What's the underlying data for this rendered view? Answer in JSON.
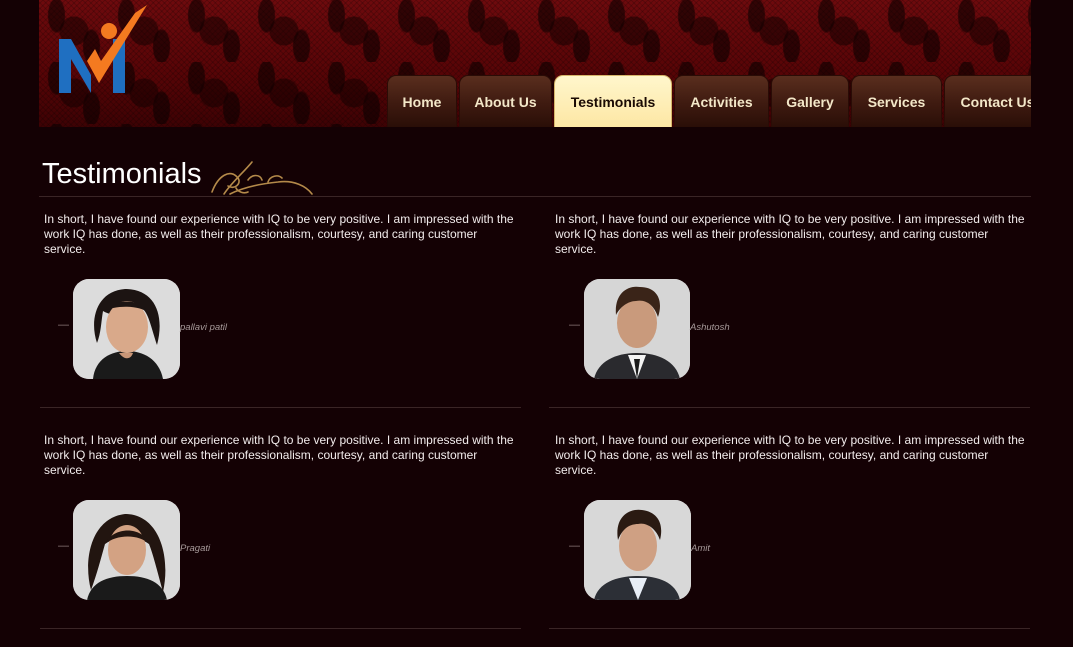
{
  "brand": {
    "accent": "#f47a20",
    "logo_blue": "#1f6fc1"
  },
  "nav": {
    "tabs": [
      {
        "label": "Home",
        "active": false
      },
      {
        "label": "About Us",
        "active": false
      },
      {
        "label": "Testimonials",
        "active": true
      },
      {
        "label": "Activities",
        "active": false
      },
      {
        "label": "Gallery",
        "active": false
      },
      {
        "label": "Services",
        "active": false
      },
      {
        "label": "Contact Us",
        "active": false
      }
    ]
  },
  "page": {
    "title": "Testimonials"
  },
  "testimonials": [
    {
      "quote": "In short, I have found our experience with IQ to be very positive. I am impressed with the work IQ has done, as well as their professionalism, courtesy, and caring customer service.",
      "dash": "—",
      "name": "pallavi patil"
    },
    {
      "quote": "In short, I have found our experience with IQ to be very positive. I am impressed with the work IQ has done, as well as their professionalism, courtesy, and caring customer service.",
      "dash": "—",
      "name": "Ashutosh"
    },
    {
      "quote": "In short, I have found our experience with IQ to be very positive. I am impressed with the work IQ has done, as well as their professionalism, courtesy, and caring customer service.",
      "dash": "—",
      "name": "Pragati"
    },
    {
      "quote": "In short, I have found our experience with IQ to be very positive. I am impressed with the work IQ has done, as well as their professionalism, courtesy, and caring customer service.",
      "dash": "—",
      "name": "Amit"
    }
  ]
}
